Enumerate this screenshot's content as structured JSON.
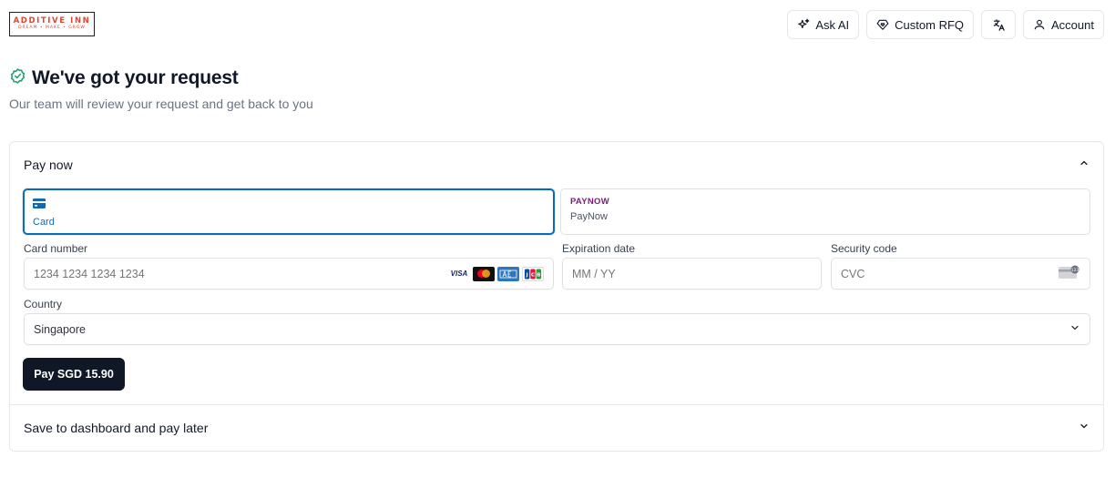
{
  "header": {
    "logo": {
      "main": "ADDITIVE INN",
      "tagline": "DREAM • MAKE • GROW",
      "color": "#e0462f"
    },
    "nav": {
      "ask_ai": "Ask AI",
      "custom_rfq": "Custom RFQ",
      "account": "Account"
    }
  },
  "confirmation": {
    "title": "We've got your request",
    "subtitle": "Our team will review your request and get back to you",
    "icon": "check-circle-icon",
    "icon_color": "#22a06b"
  },
  "pay_now": {
    "heading": "Pay now",
    "expanded": true,
    "methods": [
      {
        "label": "Card",
        "icon": "card-icon",
        "selected": true
      },
      {
        "label": "PayNow",
        "logo_text": "PAYNOW",
        "selected": false
      }
    ],
    "card_number": {
      "label": "Card number",
      "placeholder": "1234 1234 1234 1234",
      "brands": [
        "VISA",
        "Mastercard",
        "American Express",
        "JCB"
      ]
    },
    "expiration": {
      "label": "Expiration date",
      "placeholder": "MM / YY"
    },
    "security": {
      "label": "Security code",
      "placeholder": "CVC"
    },
    "country": {
      "label": "Country",
      "value": "Singapore"
    },
    "pay_button": "Pay SGD 15.90",
    "accent_color": "#0f6ab4"
  },
  "pay_later": {
    "heading": "Save to dashboard and pay later",
    "expanded": false
  }
}
